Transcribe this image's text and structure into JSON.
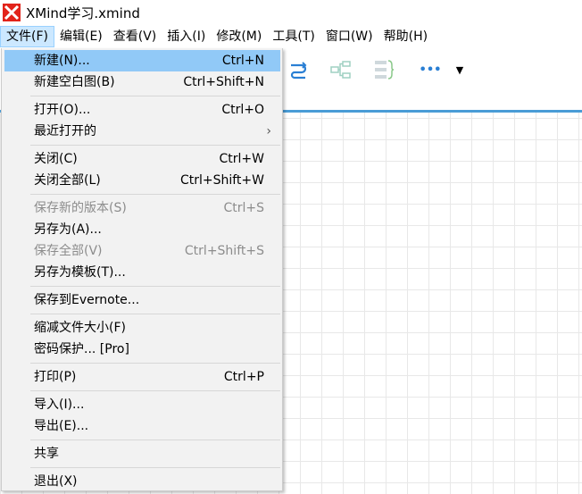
{
  "window": {
    "title": "XMind学习.xmind"
  },
  "menubar": [
    {
      "label": "文件(F)",
      "active": true
    },
    {
      "label": "编辑(E)"
    },
    {
      "label": "查看(V)"
    },
    {
      "label": "插入(I)"
    },
    {
      "label": "修改(M)"
    },
    {
      "label": "工具(T)"
    },
    {
      "label": "窗口(W)"
    },
    {
      "label": "帮助(H)"
    }
  ],
  "file_menu": {
    "items": [
      {
        "label": "新建(N)...",
        "shortcut": "Ctrl+N",
        "highlighted": true
      },
      {
        "label": "新建空白图(B)",
        "shortcut": "Ctrl+Shift+N"
      },
      {
        "label": "打开(O)...",
        "shortcut": "Ctrl+O"
      },
      {
        "label": "最近打开的",
        "submenu": "›"
      },
      {
        "label": "关闭(C)",
        "shortcut": "Ctrl+W"
      },
      {
        "label": "关闭全部(L)",
        "shortcut": "Ctrl+Shift+W"
      },
      {
        "label": "保存新的版本(S)",
        "shortcut": "Ctrl+S",
        "disabled": true
      },
      {
        "label": "另存为(A)..."
      },
      {
        "label": "保存全部(V)",
        "shortcut": "Ctrl+Shift+S",
        "disabled": true
      },
      {
        "label": "另存为模板(T)..."
      },
      {
        "label": "保存到Evernote..."
      },
      {
        "label": "缩减文件大小(F)"
      },
      {
        "label": "密码保护... [Pro]"
      },
      {
        "label": "打印(P)",
        "shortcut": "Ctrl+P"
      },
      {
        "label": "导入(I)..."
      },
      {
        "label": "导出(E)..."
      },
      {
        "label": "共享"
      },
      {
        "label": "退出(X)"
      }
    ]
  },
  "toolbar": {
    "icons": [
      "relationship-icon",
      "summary-tree-icon",
      "boundary-icon",
      "more-icon",
      "dropdown-arrow-icon"
    ],
    "more_glyph": "•••",
    "dropdown_glyph": "▼"
  },
  "colors": {
    "accent": "#4a9cd6",
    "highlight": "#91c9f7",
    "menu_bg": "#f2f2f2",
    "logo": "#e2231a"
  }
}
